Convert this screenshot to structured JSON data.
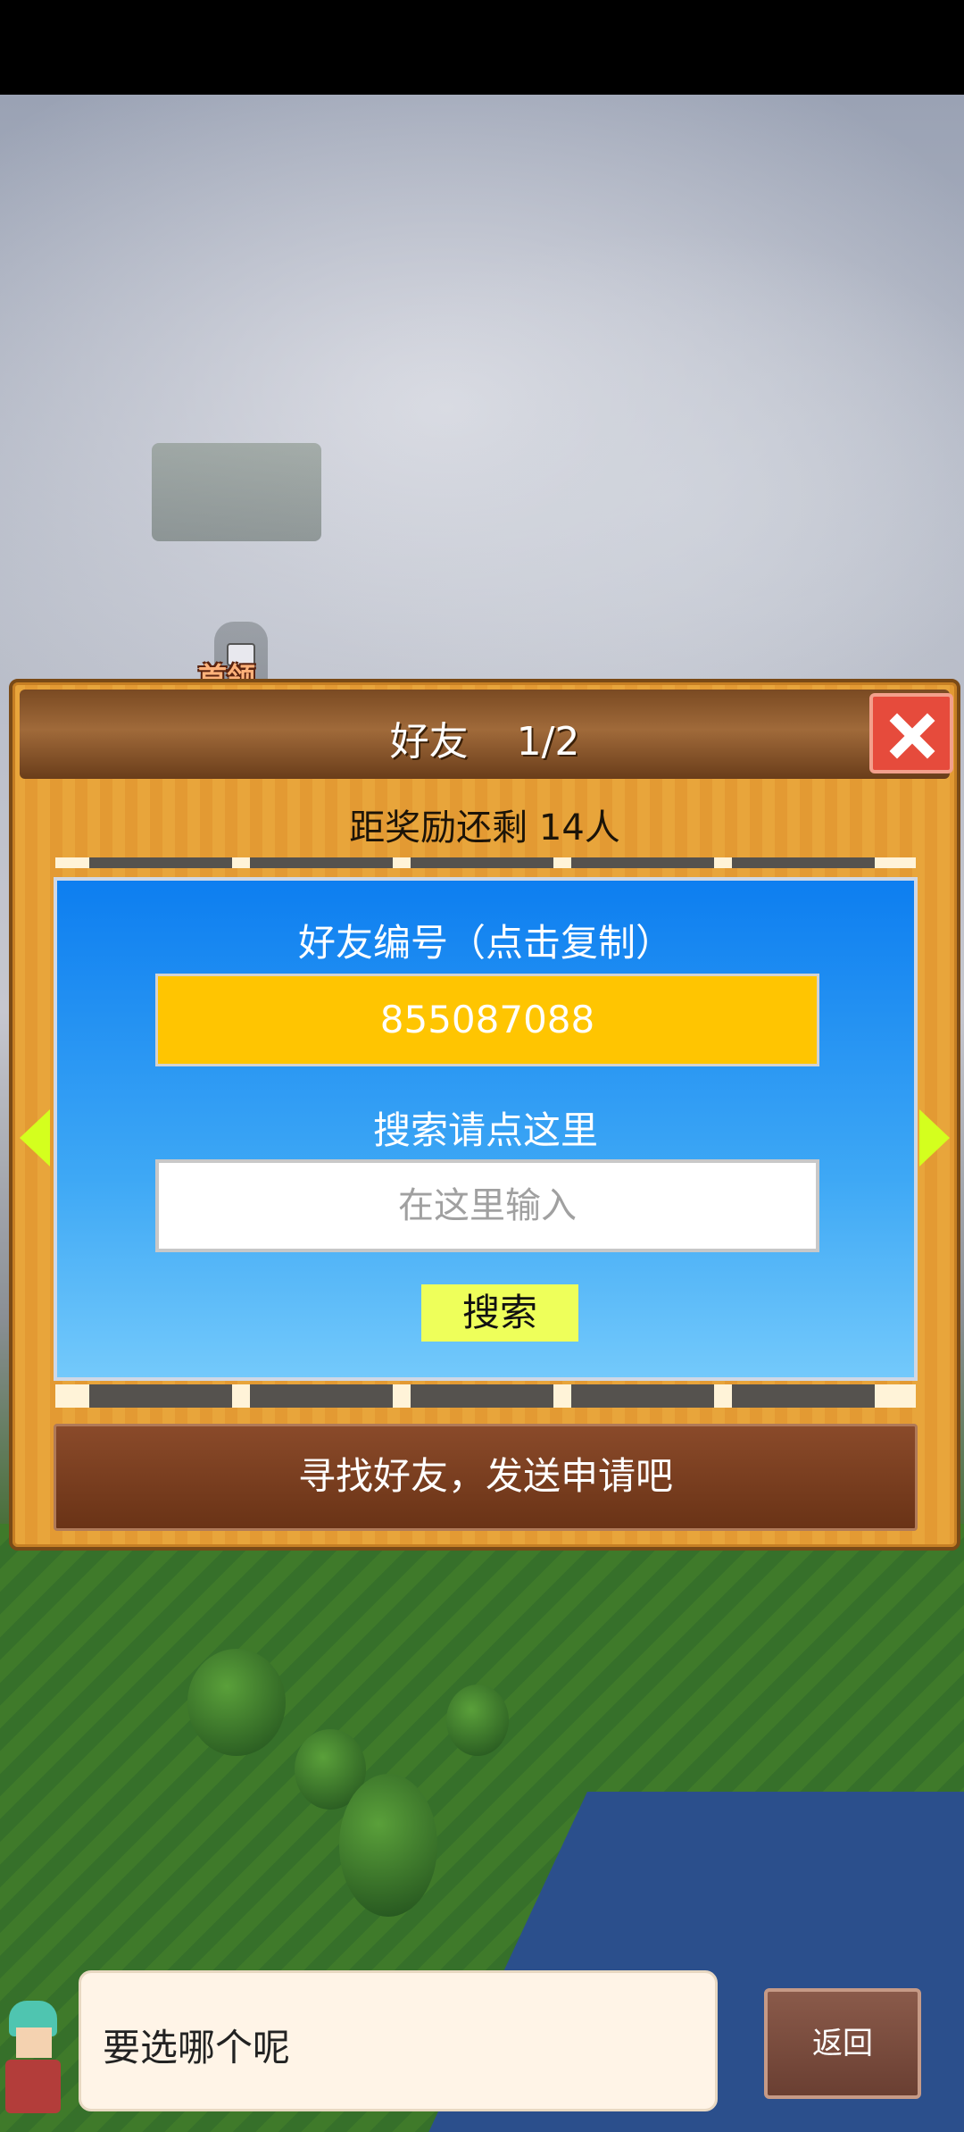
{
  "map": {
    "boss_label": "首领"
  },
  "dialog": {
    "title": "好友",
    "page": "1/2",
    "reward_text": "距奖励还剩 14人",
    "friend_id_label": "好友编号（点击复制）",
    "friend_id": "855087088",
    "search_label": "搜索请点这里",
    "search_placeholder": "在这里输入",
    "search_button": "搜索",
    "find_button": "寻找好友，发送申请吧"
  },
  "bottom": {
    "chat_text": "要选哪个呢",
    "back_button": "返回"
  },
  "colors": {
    "panel_blue": "#0d7ef0",
    "id_yellow": "#ffc501",
    "search_btn": "#eeff5a",
    "close_red": "#e64b3c",
    "arrow_green": "#d4ff1e"
  }
}
